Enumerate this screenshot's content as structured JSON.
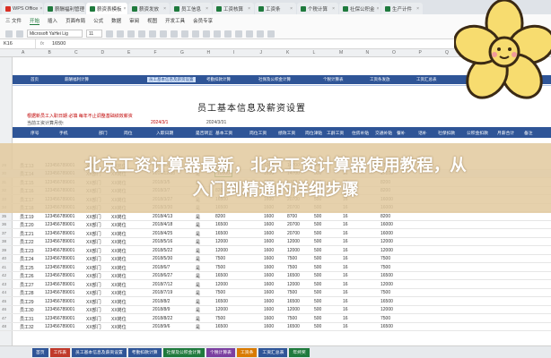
{
  "app": {
    "tabs": [
      {
        "label": "WPS Office",
        "color": "#d93025"
      },
      {
        "label": "薪酬福利管理",
        "color": "#1f7a3d"
      },
      {
        "label": "薪资表模板",
        "color": "#1f7a3d"
      },
      {
        "label": "薪资发放",
        "color": "#1f7a3d"
      },
      {
        "label": "员工信息",
        "color": "#1f7a3d"
      },
      {
        "label": "工资核算",
        "color": "#1f7a3d"
      },
      {
        "label": "工资条",
        "color": "#1f7a3d"
      },
      {
        "label": "个税计算",
        "color": "#1f7a3d"
      },
      {
        "label": "社保公积金",
        "color": "#1f7a3d"
      },
      {
        "label": "生产计件",
        "color": "#1f7a3d"
      }
    ]
  },
  "ribbon": {
    "menu": [
      "三 文件",
      "开始",
      "插入",
      "页面布局",
      "公式",
      "数据",
      "审阅",
      "视图",
      "开发工具",
      "会员专享"
    ],
    "active_menu": "开始",
    "font": "Microsoft YaHei Lig",
    "size": "11"
  },
  "formula_bar": {
    "cell": "K16",
    "fx": "fx",
    "value": "16500"
  },
  "columns": [
    "A",
    "B",
    "C",
    "D",
    "E",
    "F",
    "G",
    "H",
    "I",
    "J",
    "K",
    "L",
    "M",
    "N",
    "O",
    "P",
    "Q",
    "R",
    "S",
    "T"
  ],
  "nav_band": [
    "首页",
    "薪酬福利计算",
    "员工基本信息及薪资设置",
    "考勤扣款计算",
    "社保及公积金计算",
    "个税计算表",
    "工资条发放",
    "工资汇总表",
    "年终奖计算"
  ],
  "sheet": {
    "title": "员工基本信息及薪资设置",
    "note1": "根据新员工入职日期 必填 每年不止调整基础绩效薪资",
    "note2": "当前工资计算月份:",
    "date1": "2024/3/1",
    "date2": "2024/3/31",
    "headers": [
      "序号",
      "手机",
      "部门",
      "岗位",
      "入职日期",
      "是否转正",
      "基本工资",
      "岗位工资",
      "绩效工资",
      "岗位津贴",
      "工龄工资",
      "住房补贴",
      "交通补贴",
      "餐补",
      "话补",
      "社保扣款",
      "公积金扣款",
      "月薪合计",
      "备注"
    ]
  },
  "banner": {
    "line1": "北京工资计算器最新，北京工资计算器使用教程，从",
    "line2": "入门到精通的详细步骤"
  },
  "rows": [
    {
      "n": "29",
      "id": "员工13",
      "phone": "123456789001",
      "dept": "XX部门",
      "pos": "XX岗位",
      "date": "2017/12/16",
      "reg": "是",
      "base": "10500",
      "p2": "1600",
      "p3": "14700",
      "p4": "500",
      "p5": "16",
      "total": "17100"
    },
    {
      "n": "30",
      "id": "员工14",
      "phone": "123456789001",
      "dept": "XX部门",
      "pos": "XX岗位",
      "date": "2017/12/18",
      "reg": "是",
      "base": "10500",
      "p2": "1600",
      "p3": "14700",
      "p4": "500",
      "p5": "16",
      "total": "17100"
    },
    {
      "n": "31",
      "id": "员工15",
      "phone": "123456789001",
      "dept": "XX部门",
      "pos": "XX岗位",
      "date": "2018/3/5",
      "reg": "是",
      "base": "8200",
      "p2": "1600",
      "p3": "8700",
      "p4": "500",
      "p5": "16",
      "total": "8200"
    },
    {
      "n": "32",
      "id": "员工16",
      "phone": "123456789001",
      "dept": "XX部门",
      "pos": "XX岗位",
      "date": "2018/3/7",
      "reg": "是",
      "base": "8200",
      "p2": "1600",
      "p3": "8700",
      "p4": "500",
      "p5": "16",
      "total": "8200"
    },
    {
      "n": "33",
      "id": "员工17",
      "phone": "123456789001",
      "dept": "XX部门",
      "pos": "XX岗位",
      "date": "2018/3/27",
      "reg": "是",
      "base": "16500",
      "p2": "1600",
      "p3": "20700",
      "p4": "500",
      "p5": "16",
      "total": "16000"
    },
    {
      "n": "34",
      "id": "员工18",
      "phone": "123456789001",
      "dept": "XX部门",
      "pos": "XX岗位",
      "date": "2018/3/30",
      "reg": "是",
      "base": "16500",
      "p2": "1600",
      "p3": "20700",
      "p4": "500",
      "p5": "16",
      "total": "16000"
    },
    {
      "n": "35",
      "id": "员工19",
      "phone": "123456789001",
      "dept": "XX部门",
      "pos": "XX岗位",
      "date": "2018/4/13",
      "reg": "是",
      "base": "8200",
      "p2": "1600",
      "p3": "8700",
      "p4": "500",
      "p5": "16",
      "total": "8200"
    },
    {
      "n": "36",
      "id": "员工20",
      "phone": "123456789001",
      "dept": "XX部门",
      "pos": "XX岗位",
      "date": "2018/4/18",
      "reg": "是",
      "base": "16500",
      "p2": "1600",
      "p3": "20700",
      "p4": "500",
      "p5": "16",
      "total": "16000"
    },
    {
      "n": "37",
      "id": "员工21",
      "phone": "123456789001",
      "dept": "XX部门",
      "pos": "XX岗位",
      "date": "2018/4/25",
      "reg": "是",
      "base": "16500",
      "p2": "1600",
      "p3": "20700",
      "p4": "500",
      "p5": "16",
      "total": "16000"
    },
    {
      "n": "38",
      "id": "员工22",
      "phone": "123456789001",
      "dept": "XX部门",
      "pos": "XX岗位",
      "date": "2018/5/16",
      "reg": "是",
      "base": "12000",
      "p2": "1600",
      "p3": "12000",
      "p4": "500",
      "p5": "16",
      "total": "12000"
    },
    {
      "n": "39",
      "id": "员工23",
      "phone": "123456789001",
      "dept": "XX部门",
      "pos": "XX岗位",
      "date": "2018/5/22",
      "reg": "是",
      "base": "12000",
      "p2": "1600",
      "p3": "12000",
      "p4": "500",
      "p5": "16",
      "total": "12000"
    },
    {
      "n": "40",
      "id": "员工24",
      "phone": "123456789001",
      "dept": "XX部门",
      "pos": "XX岗位",
      "date": "2018/5/30",
      "reg": "是",
      "base": "7500",
      "p2": "1600",
      "p3": "7500",
      "p4": "500",
      "p5": "16",
      "total": "7500"
    },
    {
      "n": "41",
      "id": "员工25",
      "phone": "123456789001",
      "dept": "XX部门",
      "pos": "XX岗位",
      "date": "2018/6/7",
      "reg": "是",
      "base": "7500",
      "p2": "1600",
      "p3": "7500",
      "p4": "500",
      "p5": "16",
      "total": "7500"
    },
    {
      "n": "42",
      "id": "员工26",
      "phone": "123456789001",
      "dept": "XX部门",
      "pos": "XX岗位",
      "date": "2018/6/27",
      "reg": "是",
      "base": "16500",
      "p2": "1600",
      "p3": "16500",
      "p4": "500",
      "p5": "16",
      "total": "16500"
    },
    {
      "n": "43",
      "id": "员工27",
      "phone": "123456789001",
      "dept": "XX部门",
      "pos": "XX岗位",
      "date": "2018/7/12",
      "reg": "是",
      "base": "12000",
      "p2": "1600",
      "p3": "12000",
      "p4": "500",
      "p5": "16",
      "total": "12000"
    },
    {
      "n": "44",
      "id": "员工28",
      "phone": "123456789001",
      "dept": "XX部门",
      "pos": "XX岗位",
      "date": "2018/7/19",
      "reg": "是",
      "base": "7500",
      "p2": "1600",
      "p3": "7500",
      "p4": "500",
      "p5": "16",
      "total": "7500"
    },
    {
      "n": "45",
      "id": "员工29",
      "phone": "123456789001",
      "dept": "XX部门",
      "pos": "XX岗位",
      "date": "2018/8/2",
      "reg": "是",
      "base": "16500",
      "p2": "1600",
      "p3": "16500",
      "p4": "500",
      "p5": "16",
      "total": "16500"
    },
    {
      "n": "46",
      "id": "员工30",
      "phone": "123456789001",
      "dept": "XX部门",
      "pos": "XX岗位",
      "date": "2018/8/9",
      "reg": "是",
      "base": "12000",
      "p2": "1600",
      "p3": "12000",
      "p4": "500",
      "p5": "16",
      "total": "12000"
    },
    {
      "n": "47",
      "id": "员工31",
      "phone": "123456789001",
      "dept": "XX部门",
      "pos": "XX岗位",
      "date": "2018/8/22",
      "reg": "是",
      "base": "7500",
      "p2": "1600",
      "p3": "7500",
      "p4": "500",
      "p5": "16",
      "total": "7500"
    },
    {
      "n": "48",
      "id": "员工32",
      "phone": "123456789001",
      "dept": "XX部门",
      "pos": "XX岗位",
      "date": "2018/9/6",
      "reg": "是",
      "base": "16500",
      "p2": "1600",
      "p3": "16500",
      "p4": "500",
      "p5": "16",
      "total": "16500"
    }
  ],
  "sheet_tabs": [
    {
      "label": "首页",
      "color": "#2f5597"
    },
    {
      "label": "工作表",
      "color": "#c0392b"
    },
    {
      "label": "员工基本信息及薪资设置",
      "color": "#2f5597"
    },
    {
      "label": "考勤扣款计算",
      "color": "#2f5597"
    },
    {
      "label": "社保及公积金计算",
      "color": "#1f7a3d"
    },
    {
      "label": "个税计算表",
      "color": "#7b3fa0"
    },
    {
      "label": "工资条",
      "color": "#d97a00"
    },
    {
      "label": "工资汇总表",
      "color": "#2f5597"
    },
    {
      "label": "年终奖",
      "color": "#1f7a3d"
    }
  ]
}
